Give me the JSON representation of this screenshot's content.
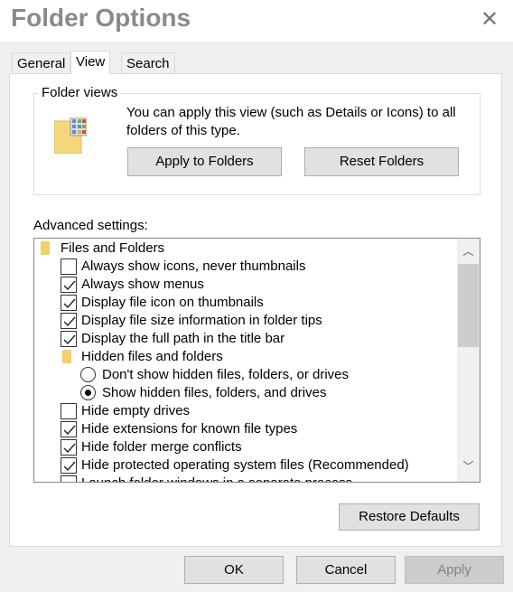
{
  "window": {
    "title": "Folder Options",
    "close_icon": "close-icon"
  },
  "tabs": [
    {
      "label": "General"
    },
    {
      "label": "View",
      "active": true
    },
    {
      "label": "Search"
    }
  ],
  "folder_views": {
    "label": "Folder views",
    "description": "You can apply this view (such as Details or Icons) to all folders of this type.",
    "apply_button": "Apply to Folders",
    "reset_button": "Reset Folders"
  },
  "advanced": {
    "label": "Advanced settings:",
    "items": [
      {
        "type": "folder",
        "level": 0,
        "label": "Files and Folders"
      },
      {
        "type": "checkbox",
        "level": 1,
        "checked": false,
        "label": "Always show icons, never thumbnails"
      },
      {
        "type": "checkbox",
        "level": 1,
        "checked": true,
        "label": "Always show menus"
      },
      {
        "type": "checkbox",
        "level": 1,
        "checked": true,
        "label": "Display file icon on thumbnails"
      },
      {
        "type": "checkbox",
        "level": 1,
        "checked": true,
        "label": "Display file size information in folder tips"
      },
      {
        "type": "checkbox",
        "level": 1,
        "checked": true,
        "label": "Display the full path in the title bar"
      },
      {
        "type": "folder",
        "level": 1,
        "label": "Hidden files and folders"
      },
      {
        "type": "radio",
        "level": 2,
        "checked": false,
        "label": "Don't show hidden files, folders, or drives"
      },
      {
        "type": "radio",
        "level": 2,
        "checked": true,
        "label": "Show hidden files, folders, and drives"
      },
      {
        "type": "checkbox",
        "level": 1,
        "checked": false,
        "label": "Hide empty drives"
      },
      {
        "type": "checkbox",
        "level": 1,
        "checked": true,
        "label": "Hide extensions for known file types"
      },
      {
        "type": "checkbox",
        "level": 1,
        "checked": true,
        "label": "Hide folder merge conflicts"
      },
      {
        "type": "checkbox",
        "level": 1,
        "checked": true,
        "label": "Hide protected operating system files (Recommended)"
      },
      {
        "type": "checkbox",
        "level": 1,
        "checked": false,
        "label": "Launch folder windows in a separate process"
      }
    ],
    "restore_button": "Restore Defaults"
  },
  "footer": {
    "ok": "OK",
    "cancel": "Cancel",
    "apply": "Apply",
    "apply_disabled": true
  },
  "colors": {
    "folder": "#f3cf6a",
    "button": "#e1e1e1",
    "title": "#8a8a8a"
  }
}
